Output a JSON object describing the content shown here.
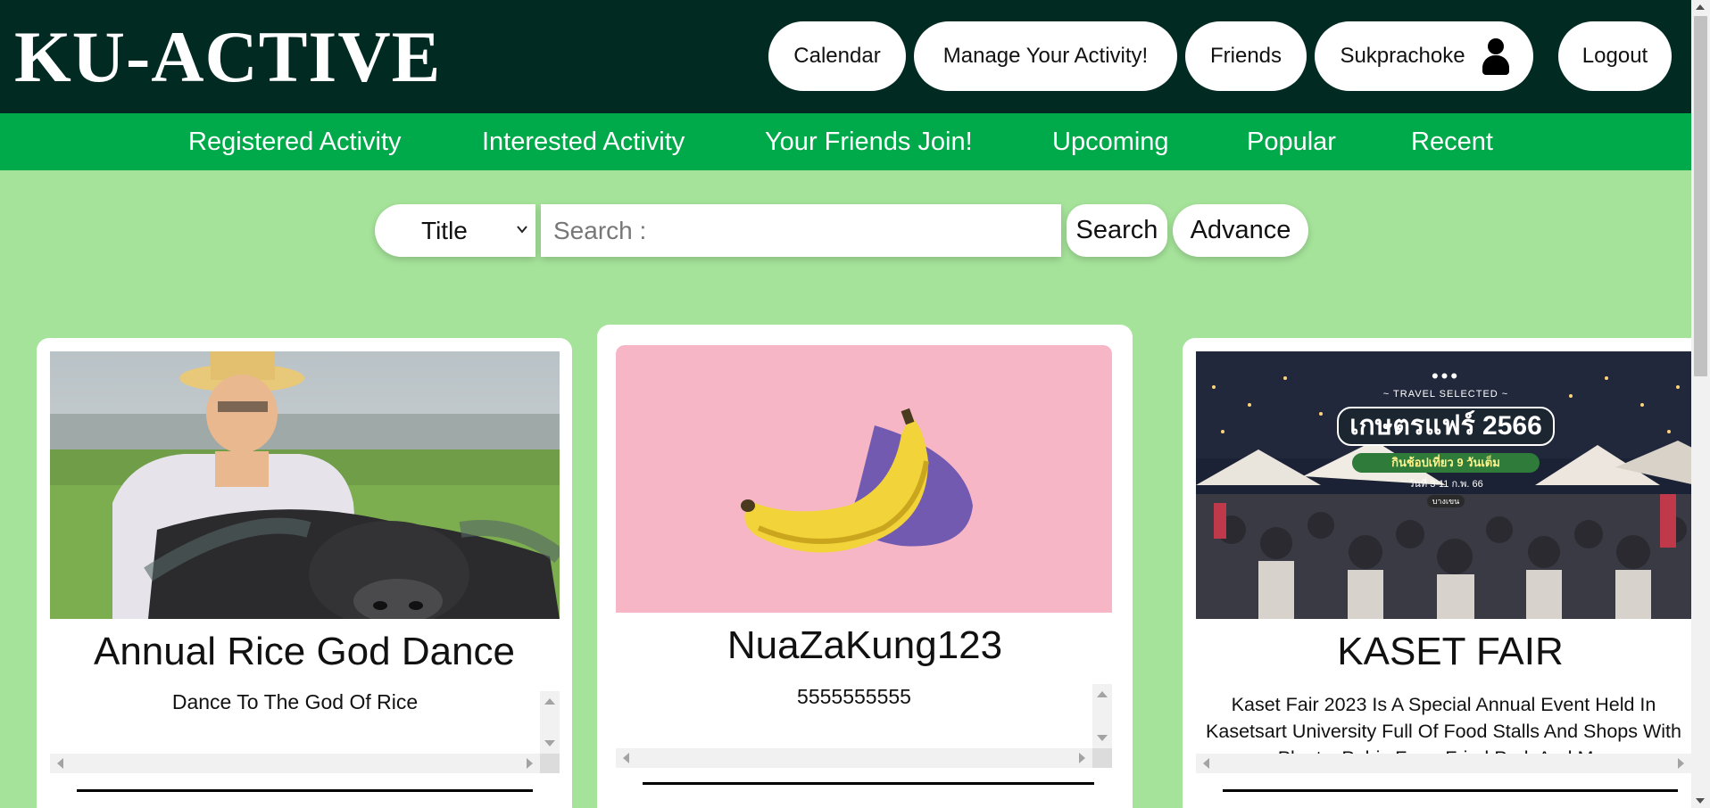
{
  "app": {
    "logo": "KU-ACTIVE"
  },
  "header": {
    "calendar_label": "Calendar",
    "manage_label": "Manage Your Activity!",
    "friends_label": "Friends",
    "user_label": "Sukprachoke",
    "user_icon": "person-icon",
    "logout_label": "Logout"
  },
  "nav": {
    "items": [
      {
        "label": "Registered Activity"
      },
      {
        "label": "Interested Activity"
      },
      {
        "label": "Your Friends Join!"
      },
      {
        "label": "Upcoming"
      },
      {
        "label": "Popular"
      },
      {
        "label": "Recent"
      }
    ]
  },
  "search": {
    "select_value": "Title",
    "placeholder": "Search :",
    "value": "",
    "search_label": "Search",
    "advance_label": "Advance"
  },
  "cards": [
    {
      "title": "Annual Rice God Dance",
      "description": "Dance To The God Of Rice",
      "image": "person-with-buffalo-photo"
    },
    {
      "title": "NuaZaKung123",
      "description": "5555555555",
      "image": "banana-photo"
    },
    {
      "title": "KASET FAIR",
      "description": "Kaset Fair 2023 Is A Special Annual Event Held In Kasetsart University Full Of Food Stalls And Shops With Plants, Pubic Farm Fried Park And M...",
      "image": "kaset-fair-poster",
      "image_text": {
        "line1": "~ TRAVEL SELECTED ~",
        "line2": "เกษตรแฟร์ 2566",
        "line3": "กินช้อปเที่ยว 9 วันเต็ม",
        "line4": "วันที่ 3-11 ก.พ. 66",
        "line5": "บางเขน"
      }
    }
  ],
  "colors": {
    "header_bg": "#002a22",
    "nav_bg": "#00a94a",
    "page_bg": "#a5e39a",
    "banana_bg": "#f6b6c5"
  }
}
